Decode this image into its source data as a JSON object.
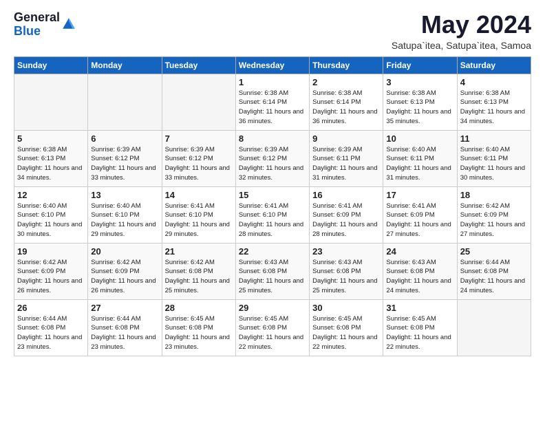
{
  "header": {
    "logo_general": "General",
    "logo_blue": "Blue",
    "month_title": "May 2024",
    "location": "Satupa`itea, Satupa`itea, Samoa"
  },
  "weekdays": [
    "Sunday",
    "Monday",
    "Tuesday",
    "Wednesday",
    "Thursday",
    "Friday",
    "Saturday"
  ],
  "weeks": [
    [
      {
        "day": "",
        "sunrise": "",
        "sunset": "",
        "daylight": ""
      },
      {
        "day": "",
        "sunrise": "",
        "sunset": "",
        "daylight": ""
      },
      {
        "day": "",
        "sunrise": "",
        "sunset": "",
        "daylight": ""
      },
      {
        "day": "1",
        "sunrise": "6:38 AM",
        "sunset": "6:14 PM",
        "daylight": "11 hours and 36 minutes."
      },
      {
        "day": "2",
        "sunrise": "6:38 AM",
        "sunset": "6:14 PM",
        "daylight": "11 hours and 36 minutes."
      },
      {
        "day": "3",
        "sunrise": "6:38 AM",
        "sunset": "6:13 PM",
        "daylight": "11 hours and 35 minutes."
      },
      {
        "day": "4",
        "sunrise": "6:38 AM",
        "sunset": "6:13 PM",
        "daylight": "11 hours and 34 minutes."
      }
    ],
    [
      {
        "day": "5",
        "sunrise": "6:38 AM",
        "sunset": "6:13 PM",
        "daylight": "11 hours and 34 minutes."
      },
      {
        "day": "6",
        "sunrise": "6:39 AM",
        "sunset": "6:12 PM",
        "daylight": "11 hours and 33 minutes."
      },
      {
        "day": "7",
        "sunrise": "6:39 AM",
        "sunset": "6:12 PM",
        "daylight": "11 hours and 33 minutes."
      },
      {
        "day": "8",
        "sunrise": "6:39 AM",
        "sunset": "6:12 PM",
        "daylight": "11 hours and 32 minutes."
      },
      {
        "day": "9",
        "sunrise": "6:39 AM",
        "sunset": "6:11 PM",
        "daylight": "11 hours and 31 minutes."
      },
      {
        "day": "10",
        "sunrise": "6:40 AM",
        "sunset": "6:11 PM",
        "daylight": "11 hours and 31 minutes."
      },
      {
        "day": "11",
        "sunrise": "6:40 AM",
        "sunset": "6:11 PM",
        "daylight": "11 hours and 30 minutes."
      }
    ],
    [
      {
        "day": "12",
        "sunrise": "6:40 AM",
        "sunset": "6:10 PM",
        "daylight": "11 hours and 30 minutes."
      },
      {
        "day": "13",
        "sunrise": "6:40 AM",
        "sunset": "6:10 PM",
        "daylight": "11 hours and 29 minutes."
      },
      {
        "day": "14",
        "sunrise": "6:41 AM",
        "sunset": "6:10 PM",
        "daylight": "11 hours and 29 minutes."
      },
      {
        "day": "15",
        "sunrise": "6:41 AM",
        "sunset": "6:10 PM",
        "daylight": "11 hours and 28 minutes."
      },
      {
        "day": "16",
        "sunrise": "6:41 AM",
        "sunset": "6:09 PM",
        "daylight": "11 hours and 28 minutes."
      },
      {
        "day": "17",
        "sunrise": "6:41 AM",
        "sunset": "6:09 PM",
        "daylight": "11 hours and 27 minutes."
      },
      {
        "day": "18",
        "sunrise": "6:42 AM",
        "sunset": "6:09 PM",
        "daylight": "11 hours and 27 minutes."
      }
    ],
    [
      {
        "day": "19",
        "sunrise": "6:42 AM",
        "sunset": "6:09 PM",
        "daylight": "11 hours and 26 minutes."
      },
      {
        "day": "20",
        "sunrise": "6:42 AM",
        "sunset": "6:09 PM",
        "daylight": "11 hours and 26 minutes."
      },
      {
        "day": "21",
        "sunrise": "6:42 AM",
        "sunset": "6:08 PM",
        "daylight": "11 hours and 25 minutes."
      },
      {
        "day": "22",
        "sunrise": "6:43 AM",
        "sunset": "6:08 PM",
        "daylight": "11 hours and 25 minutes."
      },
      {
        "day": "23",
        "sunrise": "6:43 AM",
        "sunset": "6:08 PM",
        "daylight": "11 hours and 25 minutes."
      },
      {
        "day": "24",
        "sunrise": "6:43 AM",
        "sunset": "6:08 PM",
        "daylight": "11 hours and 24 minutes."
      },
      {
        "day": "25",
        "sunrise": "6:44 AM",
        "sunset": "6:08 PM",
        "daylight": "11 hours and 24 minutes."
      }
    ],
    [
      {
        "day": "26",
        "sunrise": "6:44 AM",
        "sunset": "6:08 PM",
        "daylight": "11 hours and 23 minutes."
      },
      {
        "day": "27",
        "sunrise": "6:44 AM",
        "sunset": "6:08 PM",
        "daylight": "11 hours and 23 minutes."
      },
      {
        "day": "28",
        "sunrise": "6:45 AM",
        "sunset": "6:08 PM",
        "daylight": "11 hours and 23 minutes."
      },
      {
        "day": "29",
        "sunrise": "6:45 AM",
        "sunset": "6:08 PM",
        "daylight": "11 hours and 22 minutes."
      },
      {
        "day": "30",
        "sunrise": "6:45 AM",
        "sunset": "6:08 PM",
        "daylight": "11 hours and 22 minutes."
      },
      {
        "day": "31",
        "sunrise": "6:45 AM",
        "sunset": "6:08 PM",
        "daylight": "11 hours and 22 minutes."
      },
      {
        "day": "",
        "sunrise": "",
        "sunset": "",
        "daylight": ""
      }
    ]
  ]
}
